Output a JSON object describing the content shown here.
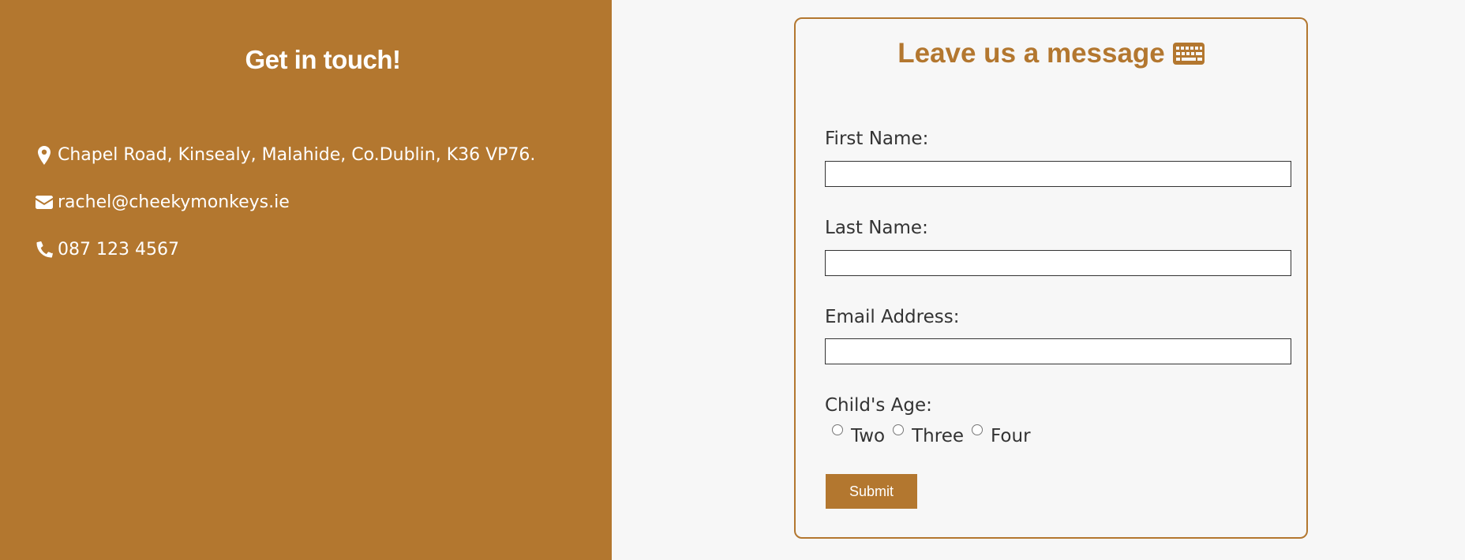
{
  "colors": {
    "accent": "#b3772f",
    "background": "#f7f7f7",
    "text": "#333333",
    "panel_text": "#ffffff"
  },
  "contact": {
    "title": "Get in touch!",
    "address": {
      "icon": "map-marker-icon",
      "text": "Chapel Road, Kinsealy, Malahide, Co.Dublin, K36 VP76."
    },
    "email": {
      "icon": "envelope-icon",
      "text": "rachel@cheekymonkeys.ie"
    },
    "phone": {
      "icon": "phone-icon",
      "text": "087 123 4567"
    }
  },
  "form": {
    "title": "Leave us a message",
    "title_icon": "keyboard-icon",
    "first_name_label": "First Name:",
    "first_name_value": "",
    "last_name_label": "Last Name:",
    "last_name_value": "",
    "email_label": "Email Address:",
    "email_value": "",
    "age_label": "Child's Age:",
    "age_options": [
      "Two",
      "Three",
      "Four"
    ],
    "submit_label": "Submit"
  }
}
